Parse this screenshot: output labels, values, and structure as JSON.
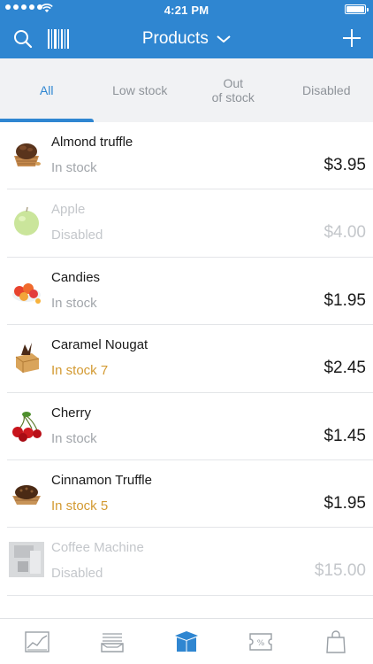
{
  "status_bar": {
    "time": "4:21 PM"
  },
  "nav": {
    "title": "Products",
    "icons": {
      "search": "search-icon",
      "barcode": "barcode-icon",
      "title_dropdown": "chevron-down-icon",
      "add": "plus-icon"
    },
    "accent_color": "#2f86d1"
  },
  "tabs": [
    {
      "label": "All",
      "active": true
    },
    {
      "label": "Low stock",
      "active": false
    },
    {
      "label": "Out\nof stock",
      "active": false
    },
    {
      "label": "Disabled",
      "active": false
    }
  ],
  "products": [
    {
      "name": "Almond truffle",
      "stock": "In stock",
      "price": "$3.95",
      "state": "normal",
      "image": "truffle-image"
    },
    {
      "name": "Apple",
      "stock": "Disabled",
      "price": "$4.00",
      "state": "disabled",
      "image": "apple-image"
    },
    {
      "name": "Candies",
      "stock": "In stock",
      "price": "$1.95",
      "state": "normal",
      "image": "candies-image"
    },
    {
      "name": "Caramel Nougat",
      "stock": "In stock 7",
      "price": "$2.45",
      "state": "low",
      "image": "nougat-image"
    },
    {
      "name": "Cherry",
      "stock": "In stock",
      "price": "$1.45",
      "state": "normal",
      "image": "cherry-image"
    },
    {
      "name": "Cinnamon Truffle",
      "stock": "In stock 5",
      "price": "$1.95",
      "state": "low",
      "image": "cinnamon-truffle-image"
    },
    {
      "name": "Coffee Machine",
      "stock": "Disabled",
      "price": "$15.00",
      "state": "disabled",
      "image": "coffee-machine-image"
    }
  ],
  "tab_bar": [
    {
      "icon": "chart-icon",
      "active": false
    },
    {
      "icon": "receipts-icon",
      "active": false
    },
    {
      "icon": "products-box-icon",
      "active": true
    },
    {
      "icon": "discount-icon",
      "active": false
    },
    {
      "icon": "shopping-bag-icon",
      "active": false
    }
  ],
  "colors": {
    "low_stock": "#d39a32",
    "muted": "#a2a6ab",
    "disabled": "#c4c7cb"
  }
}
